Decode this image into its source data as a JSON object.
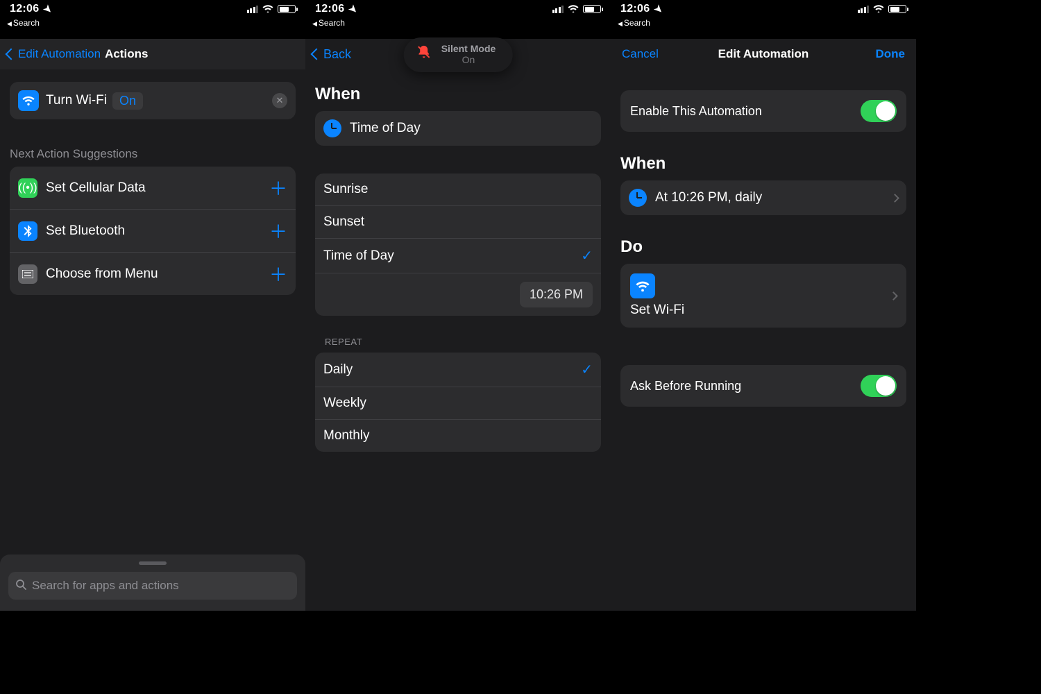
{
  "statusbar": {
    "time": "12:06",
    "back_app": "Search"
  },
  "phone1": {
    "nav_back": "Edit Automation",
    "nav_title": "Actions",
    "action": {
      "label": "Turn Wi-Fi",
      "state": "On"
    },
    "suggestions_header": "Next Action Suggestions",
    "suggestions": [
      {
        "label": "Set Cellular Data"
      },
      {
        "label": "Set Bluetooth"
      },
      {
        "label": "Choose from Menu"
      }
    ],
    "search_placeholder": "Search for apps and actions"
  },
  "phone2": {
    "nav_back": "Back",
    "silent": {
      "line1": "Silent Mode",
      "line2": "On"
    },
    "when_header": "When",
    "trigger": "Time of Day",
    "time_options": [
      "Sunrise",
      "Sunset",
      "Time of Day"
    ],
    "time_selected_index": 2,
    "picked_time": "10:26 PM",
    "repeat_header": "REPEAT",
    "repeat_options": [
      "Daily",
      "Weekly",
      "Monthly"
    ],
    "repeat_selected_index": 0
  },
  "phone3": {
    "nav_cancel": "Cancel",
    "nav_title": "Edit Automation",
    "nav_done": "Done",
    "enable_label": "Enable This Automation",
    "when_header": "When",
    "when_value": "At 10:26 PM, daily",
    "do_header": "Do",
    "do_action": "Set Wi-Fi",
    "ask_label": "Ask Before Running"
  }
}
